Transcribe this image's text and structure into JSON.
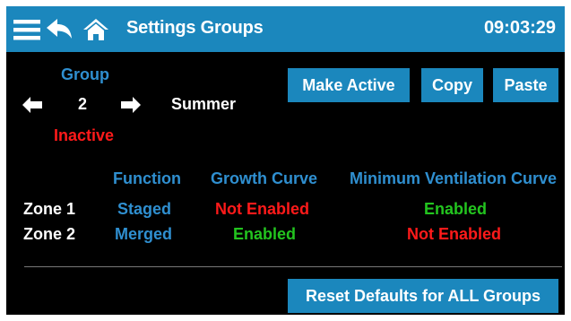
{
  "colors": {
    "accent": "#1b87bd",
    "label_blue": "#2f8fd0",
    "status_red": "#ff1a1a",
    "status_green": "#23c41f",
    "background": "#000000"
  },
  "header": {
    "title": "Settings Groups",
    "clock": "09:03:29",
    "icons": [
      "menu-icon",
      "back-icon",
      "home-icon"
    ]
  },
  "group": {
    "label": "Group",
    "number": "2",
    "name": "Summer",
    "status": "Inactive",
    "prev_icon": "arrow-left-icon",
    "next_icon": "arrow-right-icon"
  },
  "actions": {
    "make_active": "Make Active",
    "copy": "Copy",
    "paste": "Paste",
    "reset_defaults": "Reset Defaults for ALL Groups"
  },
  "table": {
    "headers": {
      "function": "Function",
      "growth_curve": "Growth Curve",
      "min_vent_curve": "Minimum Ventilation Curve"
    },
    "rows": [
      {
        "zone": "Zone 1",
        "function": "Staged",
        "growth_curve": "Not Enabled",
        "min_vent_curve": "Enabled"
      },
      {
        "zone": "Zone 2",
        "function": "Merged",
        "growth_curve": "Enabled",
        "min_vent_curve": "Not Enabled"
      }
    ]
  }
}
